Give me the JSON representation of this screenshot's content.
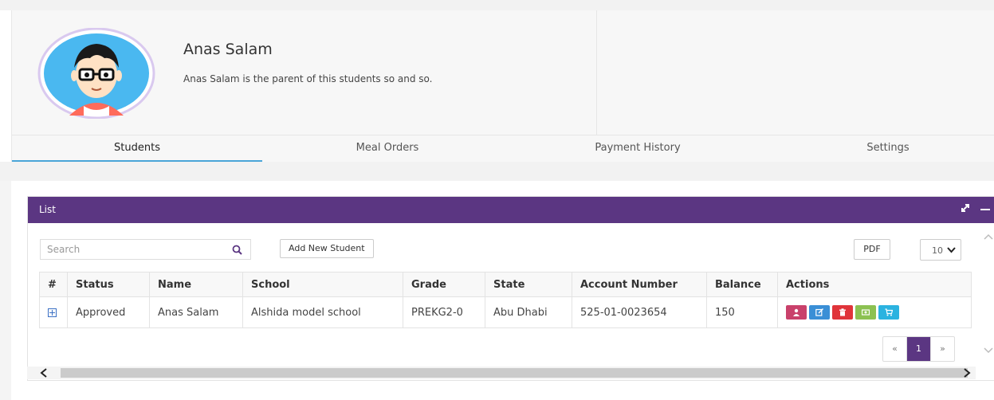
{
  "profile": {
    "name": "Anas Salam",
    "description": "Anas Salam is the parent of this students so and so."
  },
  "tabs": [
    {
      "label": "Students",
      "active": true
    },
    {
      "label": "Meal Orders",
      "active": false
    },
    {
      "label": "Payment History",
      "active": false
    },
    {
      "label": "Settings",
      "active": false
    }
  ],
  "list": {
    "title": "List",
    "search_placeholder": "Search",
    "add_button": "Add New Student",
    "pdf_button": "PDF",
    "page_size": "10",
    "columns": [
      "#",
      "Status",
      "Name",
      "School",
      "Grade",
      "State",
      "Account Number",
      "Balance",
      "Actions"
    ],
    "rows": [
      {
        "status": "Approved",
        "name": "Anas Salam",
        "school": "Alshida model school",
        "grade": "PREKG2-0",
        "state": "Abu Dhabi",
        "account_number": "525-01-0023654",
        "balance": "150"
      }
    ],
    "actions": [
      {
        "name": "profile-action-button",
        "icon": "user-icon",
        "color": "#c9416b"
      },
      {
        "name": "edit-action-button",
        "icon": "edit-icon",
        "color": "#3a8fd6"
      },
      {
        "name": "delete-action-button",
        "icon": "trash-icon",
        "color": "#e0343a"
      },
      {
        "name": "payment-action-button",
        "icon": "money-icon",
        "color": "#8cc152"
      },
      {
        "name": "order-action-button",
        "icon": "cart-icon",
        "color": "#2bb3e0"
      }
    ],
    "pagination": {
      "prev": "«",
      "current": "1",
      "next": "»"
    }
  },
  "colors": {
    "header": "#5b3682",
    "tab_active": "#4aa5d8"
  }
}
